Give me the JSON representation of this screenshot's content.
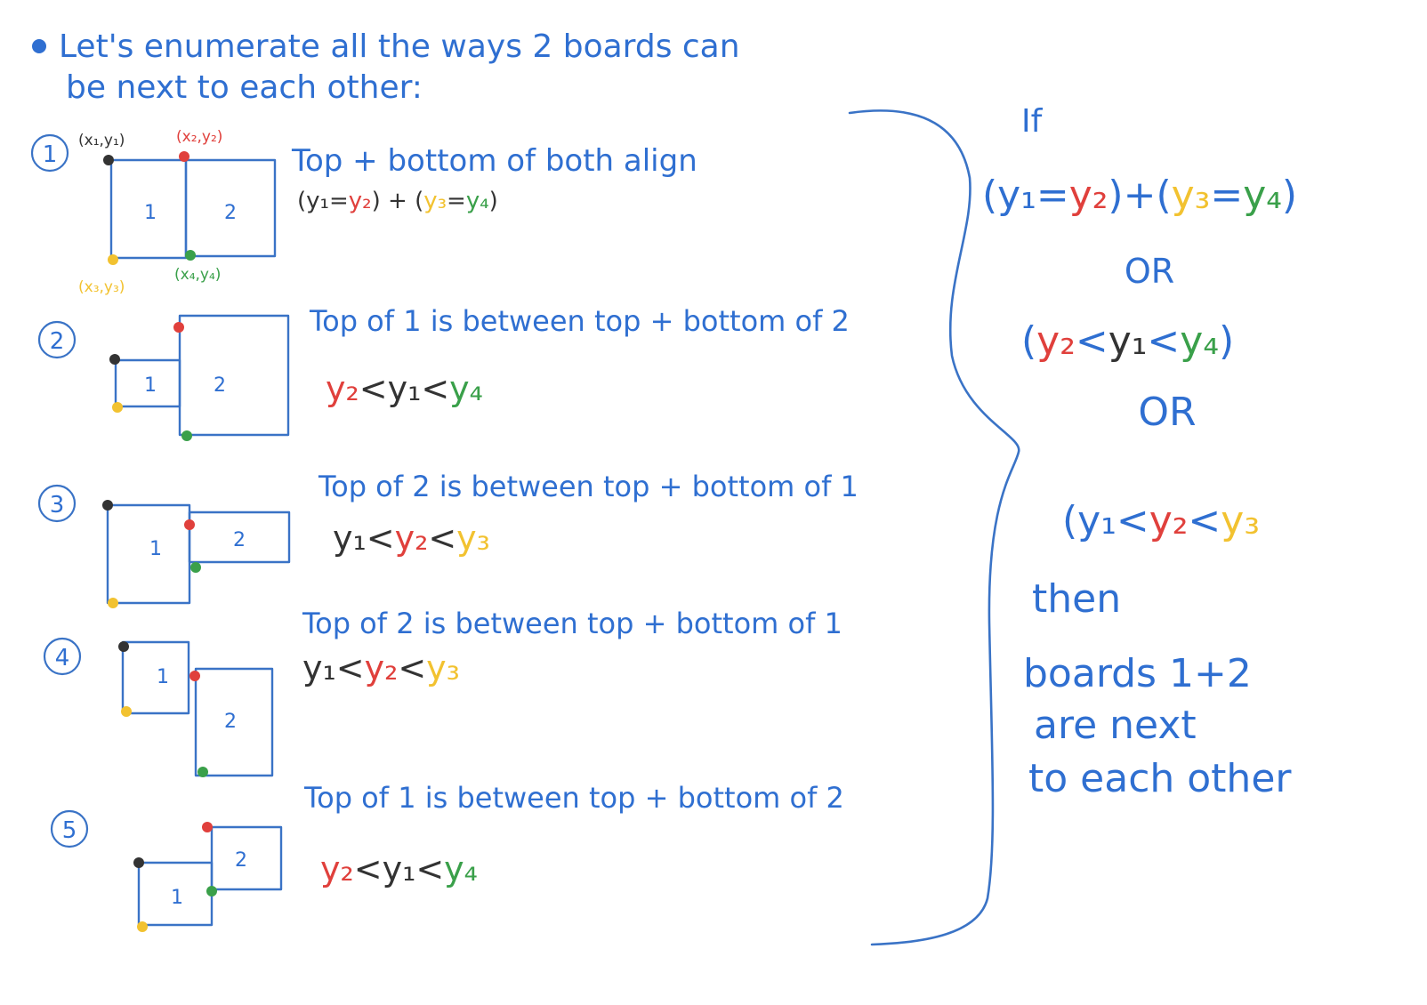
{
  "heading": {
    "line1": "Let's enumerate all the ways 2 boards can",
    "line2": "be next to each other:"
  },
  "coord_labels": {
    "p1": "(x₁,y₁)",
    "p2": "(x₂,y₂)",
    "p3": "(x₃,y₃)",
    "p4": "(x₄,y₄)"
  },
  "cases": [
    {
      "number": "1",
      "box1_label": "1",
      "box2_label": "2",
      "description": "Top + bottom of both align",
      "formula": [
        {
          "text": "(",
          "color": "black"
        },
        {
          "text": "y₁",
          "color": "black"
        },
        {
          "text": "=",
          "color": "black"
        },
        {
          "text": "y₂",
          "color": "red"
        },
        {
          "text": ")",
          "color": "black"
        },
        {
          "text": " + ",
          "color": "black"
        },
        {
          "text": "(",
          "color": "black"
        },
        {
          "text": "y₃",
          "color": "yellow"
        },
        {
          "text": "=",
          "color": "black"
        },
        {
          "text": "y₄",
          "color": "green"
        },
        {
          "text": ")",
          "color": "black"
        }
      ]
    },
    {
      "number": "2",
      "box1_label": "1",
      "box2_label": "2",
      "description": "Top of 1 is between top + bottom of 2",
      "formula": [
        {
          "text": "y₂",
          "color": "red"
        },
        {
          "text": "<",
          "color": "black"
        },
        {
          "text": "y₁",
          "color": "black"
        },
        {
          "text": "<",
          "color": "black"
        },
        {
          "text": "y₄",
          "color": "green"
        }
      ]
    },
    {
      "number": "3",
      "box1_label": "1",
      "box2_label": "2",
      "description": "Top of 2 is between top + bottom of 1",
      "formula": [
        {
          "text": "y₁",
          "color": "black"
        },
        {
          "text": "<",
          "color": "black"
        },
        {
          "text": "y₂",
          "color": "red"
        },
        {
          "text": "<",
          "color": "black"
        },
        {
          "text": "y₃",
          "color": "yellow"
        }
      ]
    },
    {
      "number": "4",
      "box1_label": "1",
      "box2_label": "2",
      "description": "Top of 2 is between top + bottom of 1",
      "formula": [
        {
          "text": "y₁",
          "color": "black"
        },
        {
          "text": "<",
          "color": "black"
        },
        {
          "text": "y₂",
          "color": "red"
        },
        {
          "text": "<",
          "color": "black"
        },
        {
          "text": "y₃",
          "color": "yellow"
        }
      ]
    },
    {
      "number": "5",
      "box1_label": "1",
      "box2_label": "2",
      "description": "Top of 1 is between top + bottom of 2",
      "formula": [
        {
          "text": "y₂",
          "color": "red"
        },
        {
          "text": "<",
          "color": "black"
        },
        {
          "text": "y₁",
          "color": "black"
        },
        {
          "text": "<",
          "color": "black"
        },
        {
          "text": "y₄",
          "color": "green"
        }
      ]
    }
  ],
  "summary": {
    "if_label": "If",
    "condition1": [
      {
        "text": "(",
        "color": "blue"
      },
      {
        "text": "y₁",
        "color": "blue"
      },
      {
        "text": "=",
        "color": "blue"
      },
      {
        "text": "y₂",
        "color": "red"
      },
      {
        "text": ")",
        "color": "blue"
      },
      {
        "text": "+",
        "color": "blue"
      },
      {
        "text": "(",
        "color": "blue"
      },
      {
        "text": "y₃",
        "color": "yellow"
      },
      {
        "text": "=",
        "color": "blue"
      },
      {
        "text": "y₄",
        "color": "green"
      },
      {
        "text": ")",
        "color": "blue"
      }
    ],
    "or1": "OR",
    "condition2": [
      {
        "text": "(",
        "color": "blue"
      },
      {
        "text": "y₂",
        "color": "red"
      },
      {
        "text": "<",
        "color": "blue"
      },
      {
        "text": "y₁",
        "color": "black"
      },
      {
        "text": "<",
        "color": "blue"
      },
      {
        "text": "y₄",
        "color": "green"
      },
      {
        "text": ")",
        "color": "blue"
      }
    ],
    "or2": "OR",
    "condition3": [
      {
        "text": "(",
        "color": "blue"
      },
      {
        "text": "y₁",
        "color": "blue"
      },
      {
        "text": "<",
        "color": "blue"
      },
      {
        "text": "y₂",
        "color": "red"
      },
      {
        "text": "<",
        "color": "blue"
      },
      {
        "text": "y₃",
        "color": "yellow"
      }
    ],
    "then": "then",
    "conclusion_line1": "boards 1+2",
    "conclusion_line2": "are next",
    "conclusion_line3": "to each other"
  },
  "colors": {
    "ink_blue": "#2f6fd1",
    "ink_black": "#333333",
    "ink_red": "#e0403c",
    "ink_yellow": "#f2c230",
    "ink_green": "#3aa04a"
  }
}
